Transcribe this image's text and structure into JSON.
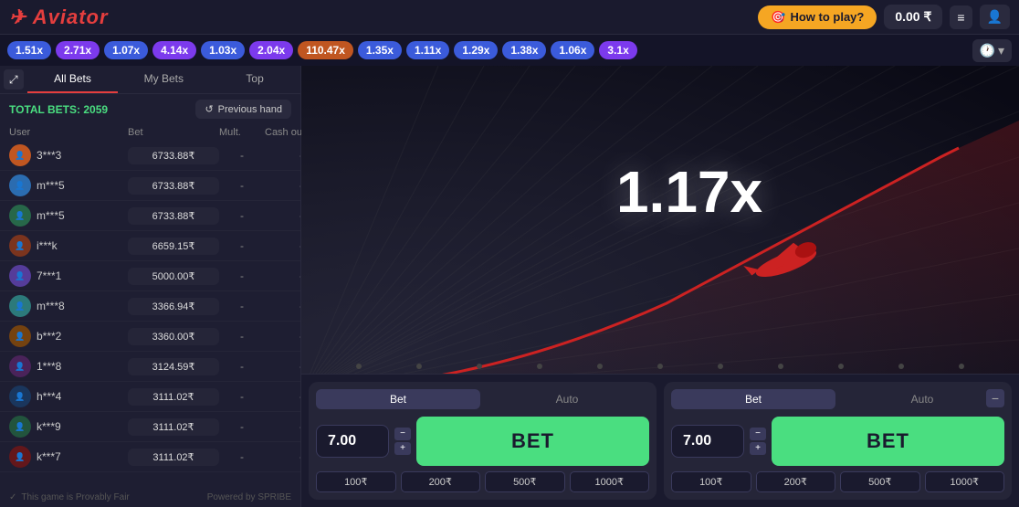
{
  "header": {
    "logo_text": "Aviator",
    "how_to_play": "How to play?",
    "balance": "0.00 ₹"
  },
  "multiplier_strip": {
    "items": [
      {
        "value": "1.51x",
        "color": "blue"
      },
      {
        "value": "2.71x",
        "color": "purple"
      },
      {
        "value": "1.07x",
        "color": "blue"
      },
      {
        "value": "4.14x",
        "color": "purple"
      },
      {
        "value": "1.03x",
        "color": "blue"
      },
      {
        "value": "2.04x",
        "color": "purple"
      },
      {
        "value": "110.47x",
        "color": "orange"
      },
      {
        "value": "1.35x",
        "color": "blue"
      },
      {
        "value": "1.11x",
        "color": "blue"
      },
      {
        "value": "1.29x",
        "color": "blue"
      },
      {
        "value": "1.38x",
        "color": "blue"
      },
      {
        "value": "1.06x",
        "color": "blue"
      },
      {
        "value": "3.1x",
        "color": "purple"
      }
    ]
  },
  "left_panel": {
    "tabs": [
      {
        "label": "All Bets",
        "active": true
      },
      {
        "label": "My Bets",
        "active": false
      },
      {
        "label": "Top",
        "active": false
      }
    ],
    "total_bets_label": "TOTAL BETS:",
    "total_bets_count": "2059",
    "prev_hand_btn": "Previous hand",
    "table_headers": [
      "User",
      "Bet",
      "Mult.",
      "Cash out"
    ],
    "bets": [
      {
        "user": "3***3",
        "bet": "6733.88₹",
        "mult": "-",
        "cash": "-",
        "av": "1"
      },
      {
        "user": "m***5",
        "bet": "6733.88₹",
        "mult": "-",
        "cash": "-",
        "av": "2"
      },
      {
        "user": "m***5",
        "bet": "6733.88₹",
        "mult": "-",
        "cash": "-",
        "av": "3"
      },
      {
        "user": "i***k",
        "bet": "6659.15₹",
        "mult": "-",
        "cash": "-",
        "av": "4"
      },
      {
        "user": "7***1",
        "bet": "5000.00₹",
        "mult": "-",
        "cash": "-",
        "av": "5"
      },
      {
        "user": "m***8",
        "bet": "3366.94₹",
        "mult": "-",
        "cash": "-",
        "av": "6"
      },
      {
        "user": "b***2",
        "bet": "3360.00₹",
        "mult": "-",
        "cash": "-",
        "av": "7"
      },
      {
        "user": "1***8",
        "bet": "3124.59₹",
        "mult": "-",
        "cash": "-",
        "av": "8"
      },
      {
        "user": "h***4",
        "bet": "3111.02₹",
        "mult": "-",
        "cash": "-",
        "av": "9"
      },
      {
        "user": "k***9",
        "bet": "3111.02₹",
        "mult": "-",
        "cash": "-",
        "av": "10"
      },
      {
        "user": "k***7",
        "bet": "3111.02₹",
        "mult": "-",
        "cash": "-",
        "av": "11"
      }
    ],
    "footer": "This game is Provably Fair",
    "footer_powered": "Powered by SPRIBE"
  },
  "game": {
    "multiplier": "1.17x"
  },
  "bet_panel_1": {
    "tab1": "Bet",
    "tab2": "Auto",
    "amount": "7.00",
    "btn_label": "BET",
    "quick_amounts": [
      "100₹",
      "200₹",
      "500₹",
      "1000₹"
    ]
  },
  "bet_panel_2": {
    "tab1": "Bet",
    "tab2": "Auto",
    "amount": "7.00",
    "btn_label": "BET",
    "quick_amounts": [
      "100₹",
      "200₹",
      "500₹",
      "1000₹"
    ]
  }
}
